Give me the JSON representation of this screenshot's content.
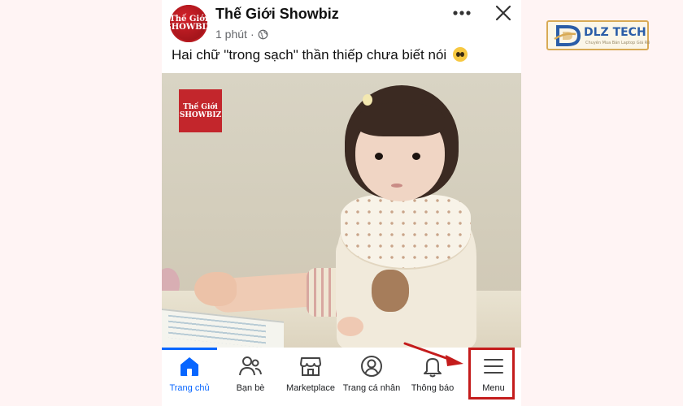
{
  "post": {
    "page_name": "Thế Giới Showbiz",
    "avatar_text": "Thế Giới SHOWBIZ",
    "time": "1 phút",
    "separator": "·",
    "caption": "Hai chữ \"trong sạch\" thần thiếp chưa biết nói",
    "caption_emoji": "pleading-face-emoji",
    "photo_watermark": "Thế Giới SHOWBIZ"
  },
  "nav": {
    "items": [
      {
        "label": "Trang chủ",
        "icon": "home-icon",
        "active": true
      },
      {
        "label": "Bạn bè",
        "icon": "friends-icon",
        "active": false
      },
      {
        "label": "Marketplace",
        "icon": "marketplace-icon",
        "active": false
      },
      {
        "label": "Trang cá nhân",
        "icon": "profile-icon",
        "active": false
      },
      {
        "label": "Thông báo",
        "icon": "bell-icon",
        "active": false
      },
      {
        "label": "Menu",
        "icon": "hamburger-menu-icon",
        "active": false
      }
    ]
  },
  "brand": {
    "name": "DLZ TECH",
    "tagline": "Chuyên Mua Bán Laptop Giá Rẻ"
  },
  "colors": {
    "accent": "#0866ff",
    "highlight": "#c41c1c",
    "avatar_red": "#c3262c"
  }
}
